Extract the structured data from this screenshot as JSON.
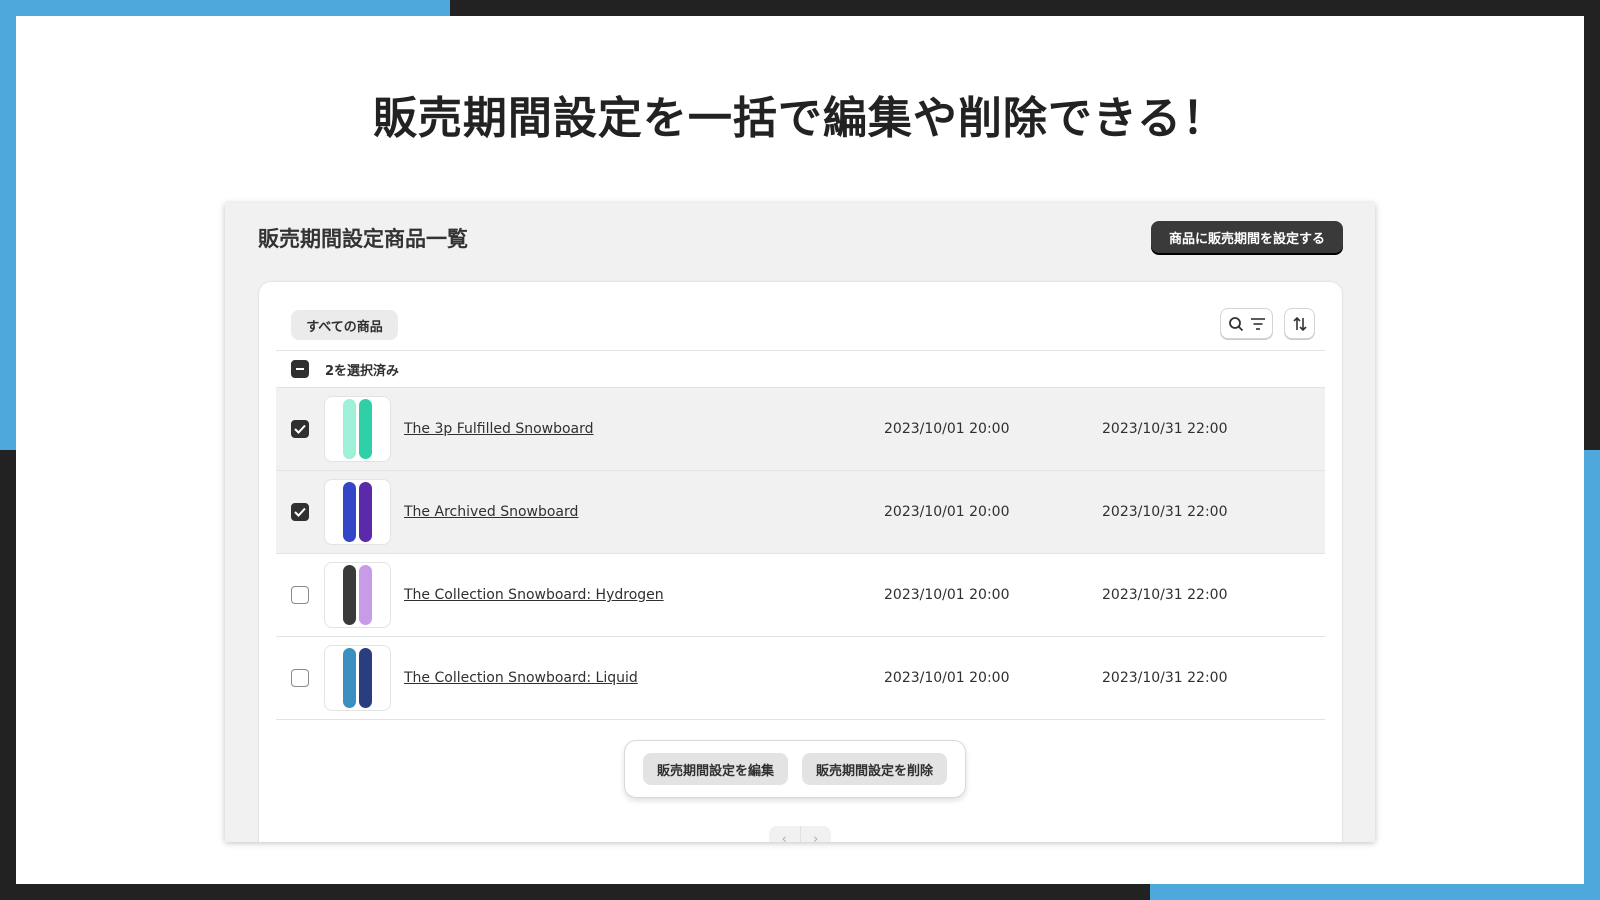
{
  "headline": "販売期間設定を一括で編集や削除できる！",
  "colors": {
    "accent_blue": "#4fa8dc",
    "frame_dark": "#222222",
    "primary_button": "#3a3a3a"
  },
  "panel": {
    "title": "販売期間設定商品一覧",
    "primary_button": "商品に販売期間を設定する",
    "tab": "すべての商品",
    "icons": [
      "search-icon",
      "filter-icon",
      "sort-icon"
    ],
    "selection_label": "2を選択済み",
    "rows": [
      {
        "name": "The 3p Fulfilled Snowboard",
        "start": "2023/10/01 20:00",
        "end": "2023/10/31 22:00",
        "selected": true,
        "colors": [
          "#9ef0d8",
          "#2fcfa8"
        ]
      },
      {
        "name": "The Archived Snowboard",
        "start": "2023/10/01 20:00",
        "end": "2023/10/31 22:00",
        "selected": true,
        "colors": [
          "#3346c8",
          "#5a2aa8"
        ]
      },
      {
        "name": "The Collection Snowboard: Hydrogen",
        "start": "2023/10/01 20:00",
        "end": "2023/10/31 22:00",
        "selected": false,
        "colors": [
          "#3a3a3a",
          "#c79be8"
        ]
      },
      {
        "name": "The Collection Snowboard: Liquid",
        "start": "2023/10/01 20:00",
        "end": "2023/10/31 22:00",
        "selected": false,
        "colors": [
          "#3a8fc0",
          "#2a3d80"
        ]
      }
    ],
    "bulk_actions": {
      "edit": "販売期間設定を編集",
      "delete": "販売期間設定を削除"
    },
    "pager": {
      "prev": "‹",
      "next": "›"
    }
  }
}
